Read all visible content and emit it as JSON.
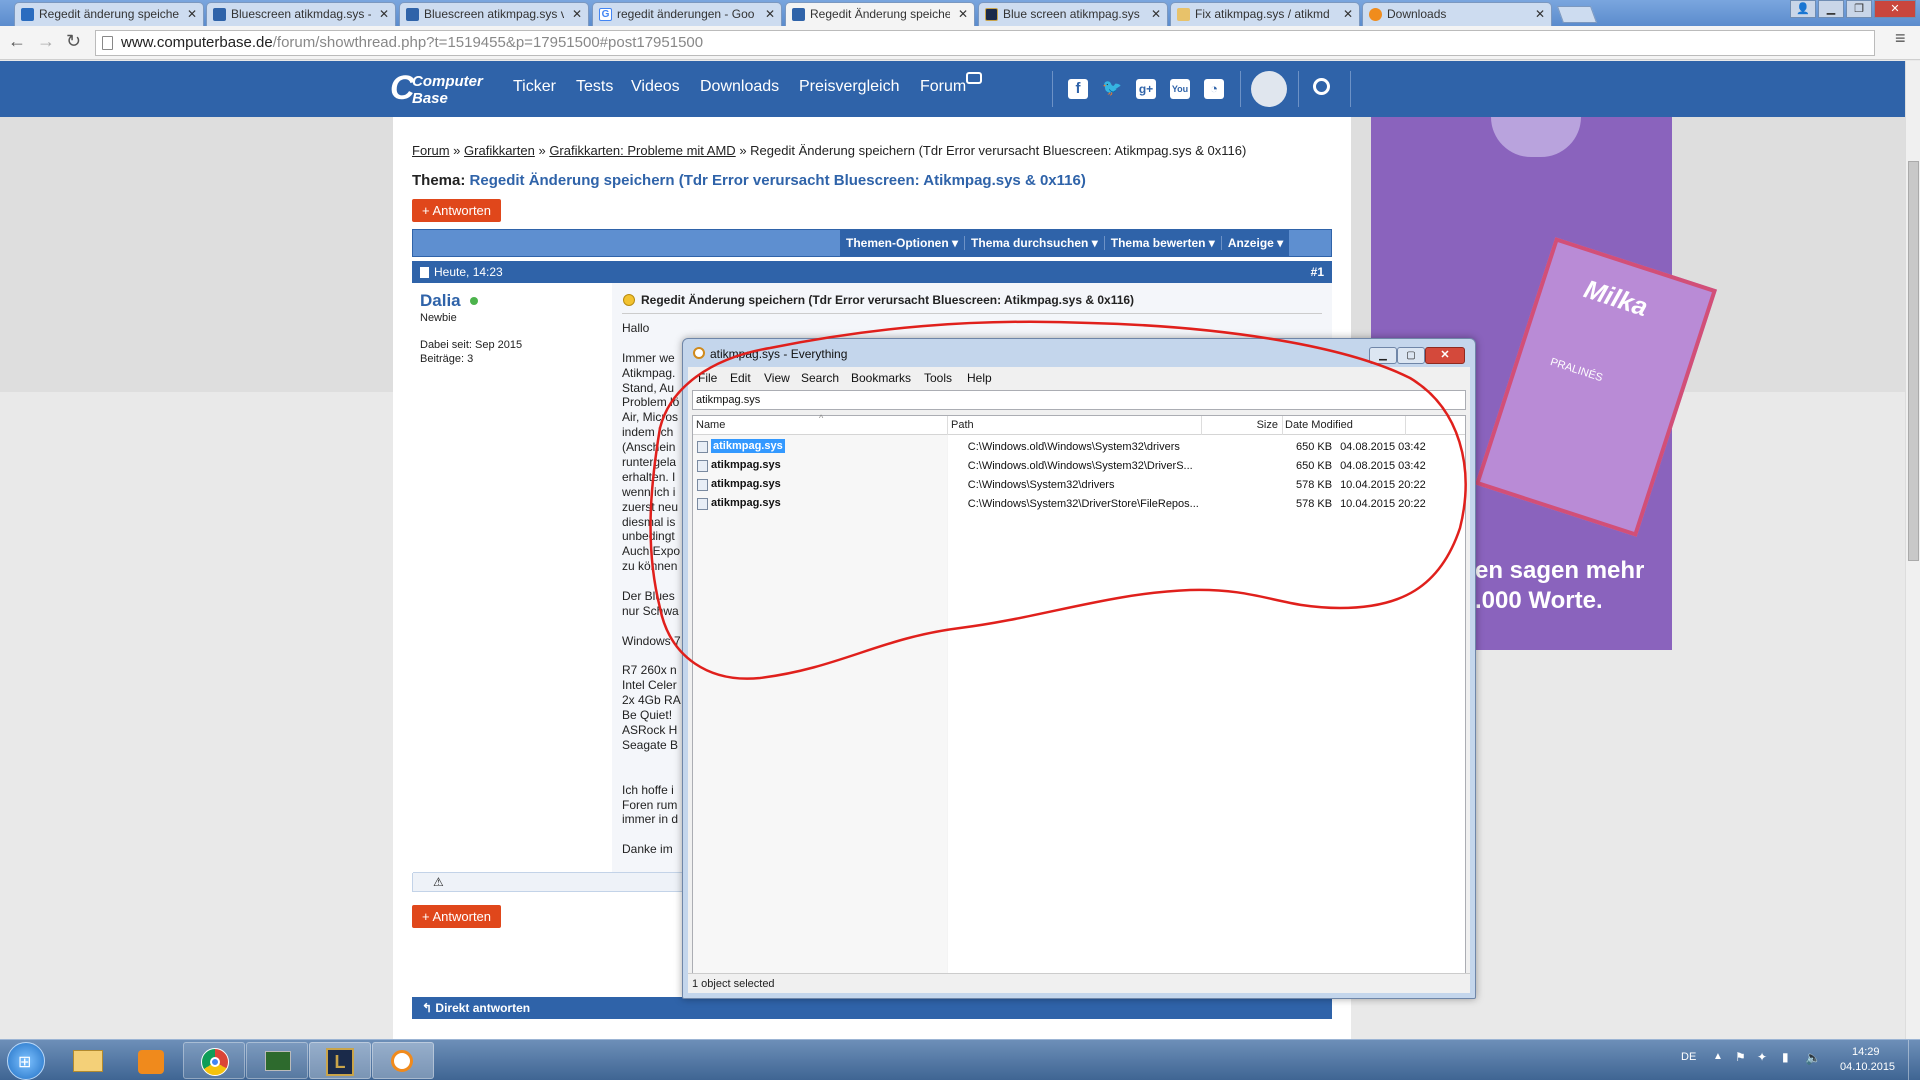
{
  "browser": {
    "tabs": [
      {
        "label": "Regedit änderung speiche",
        "fav": "#2a6cbf"
      },
      {
        "label": "Bluescreen atikmdag.sys -",
        "fav": "#2f63a9"
      },
      {
        "label": "Bluescreen atikmpag.sys v",
        "fav": "#2f63a9"
      },
      {
        "label": "regedit änderungen - Goo",
        "fav": "#4285f4"
      },
      {
        "label": "Regedit Änderung speiche",
        "fav": "#2f63a9"
      },
      {
        "label": "Blue screen atikmpag.sys",
        "fav": "#1a2a4a"
      },
      {
        "label": "Fix atikmpag.sys / atikmd",
        "fav": "#e8c26a"
      },
      {
        "label": "Downloads",
        "fav": "#f08c1c"
      }
    ],
    "url_host": "www.computerbase.de",
    "url_path": "/forum/showthread.php?t=1519455&p=17951500#post17951500"
  },
  "site": {
    "logo_line1": "Computer",
    "logo_line2": "Base",
    "nav": [
      "Ticker",
      "Tests",
      "Videos",
      "Downloads",
      "Preisvergleich",
      "Forum"
    ],
    "icons": [
      "facebook-icon",
      "twitter-icon",
      "googleplus-icon",
      "youtube-icon",
      "rss-icon"
    ]
  },
  "thread": {
    "breadcrumb": [
      "Forum",
      "Grafikkarten",
      "Grafikkarten: Probleme mit AMD",
      "Regedit Änderung speichern (Tdr Error verursacht Bluescreen: Atikmpag.sys & 0x116)"
    ],
    "title_prefix": "Thema:",
    "title": "Regedit Änderung speichern (Tdr Error verursacht Bluescreen: Atikmpag.sys & 0x116)",
    "reply_label": "+ Antworten",
    "toolbar": [
      "Themen-Optionen",
      "Thema durchsuchen",
      "Thema bewerten",
      "Anzeige"
    ],
    "post_date": "Heute, 14:23",
    "post_number": "#1",
    "username": "Dalia",
    "rank": "Newbie",
    "joined": "Dabei seit: Sep 2015",
    "posts": "Beiträge: 3",
    "post_title": "Regedit Änderung speichern (Tdr Error verursacht Bluescreen: Atikmpag.sys & 0x116)",
    "lines": [
      "Hallo",
      "",
      "Immer we",
      "Atikmpag.",
      "Stand, Au",
      "Problem lö",
      "Air, Micros",
      "indem ich",
      "(Anschein",
      "runtergela",
      "erhalten. I",
      "wenn ich i",
      "zuerst neu",
      "diesmal is",
      "unbedingt",
      "Auch Expo",
      "zu können",
      "",
      "Der Blues",
      "nur Schwa",
      "",
      "Windows 7",
      "",
      "R7 260x n",
      "Intel Celer",
      "2x 4Gb RA",
      "Be Quiet!",
      "ASRock H",
      "Seagate B",
      "",
      "",
      "Ich hoffe i",
      "Foren rum",
      "immer in d",
      "",
      "Danke im"
    ],
    "quick_reply": "Direkt antworten"
  },
  "ad": {
    "text1": "en sagen mehr",
    "text2": ".000 Worte.",
    "brand": "Milka",
    "product": "PRALINÉS"
  },
  "everything": {
    "title": "atikmpag.sys - Everything",
    "menu": [
      "File",
      "Edit",
      "View",
      "Search",
      "Bookmarks",
      "Tools",
      "Help"
    ],
    "search": "atikmpag.sys",
    "columns": [
      "Name",
      "Path",
      "Size",
      "Date Modified"
    ],
    "rows": [
      {
        "name": "atikmpag.sys",
        "path": "C:\\Windows.old\\Windows\\System32\\drivers",
        "size": "650 KB",
        "date": "04.08.2015 03:42"
      },
      {
        "name": "atikmpag.sys",
        "path": "C:\\Windows.old\\Windows\\System32\\DriverS...",
        "size": "650 KB",
        "date": "04.08.2015 03:42"
      },
      {
        "name": "atikmpag.sys",
        "path": "C:\\Windows\\System32\\drivers",
        "size": "578 KB",
        "date": "10.04.2015 20:22"
      },
      {
        "name": "atikmpag.sys",
        "path": "C:\\Windows\\System32\\DriverStore\\FileRepos...",
        "size": "578 KB",
        "date": "10.04.2015 20:22"
      }
    ],
    "status": "1 object selected"
  },
  "taskbar": {
    "lang": "DE",
    "time": "14:29",
    "date": "04.10.2015"
  }
}
